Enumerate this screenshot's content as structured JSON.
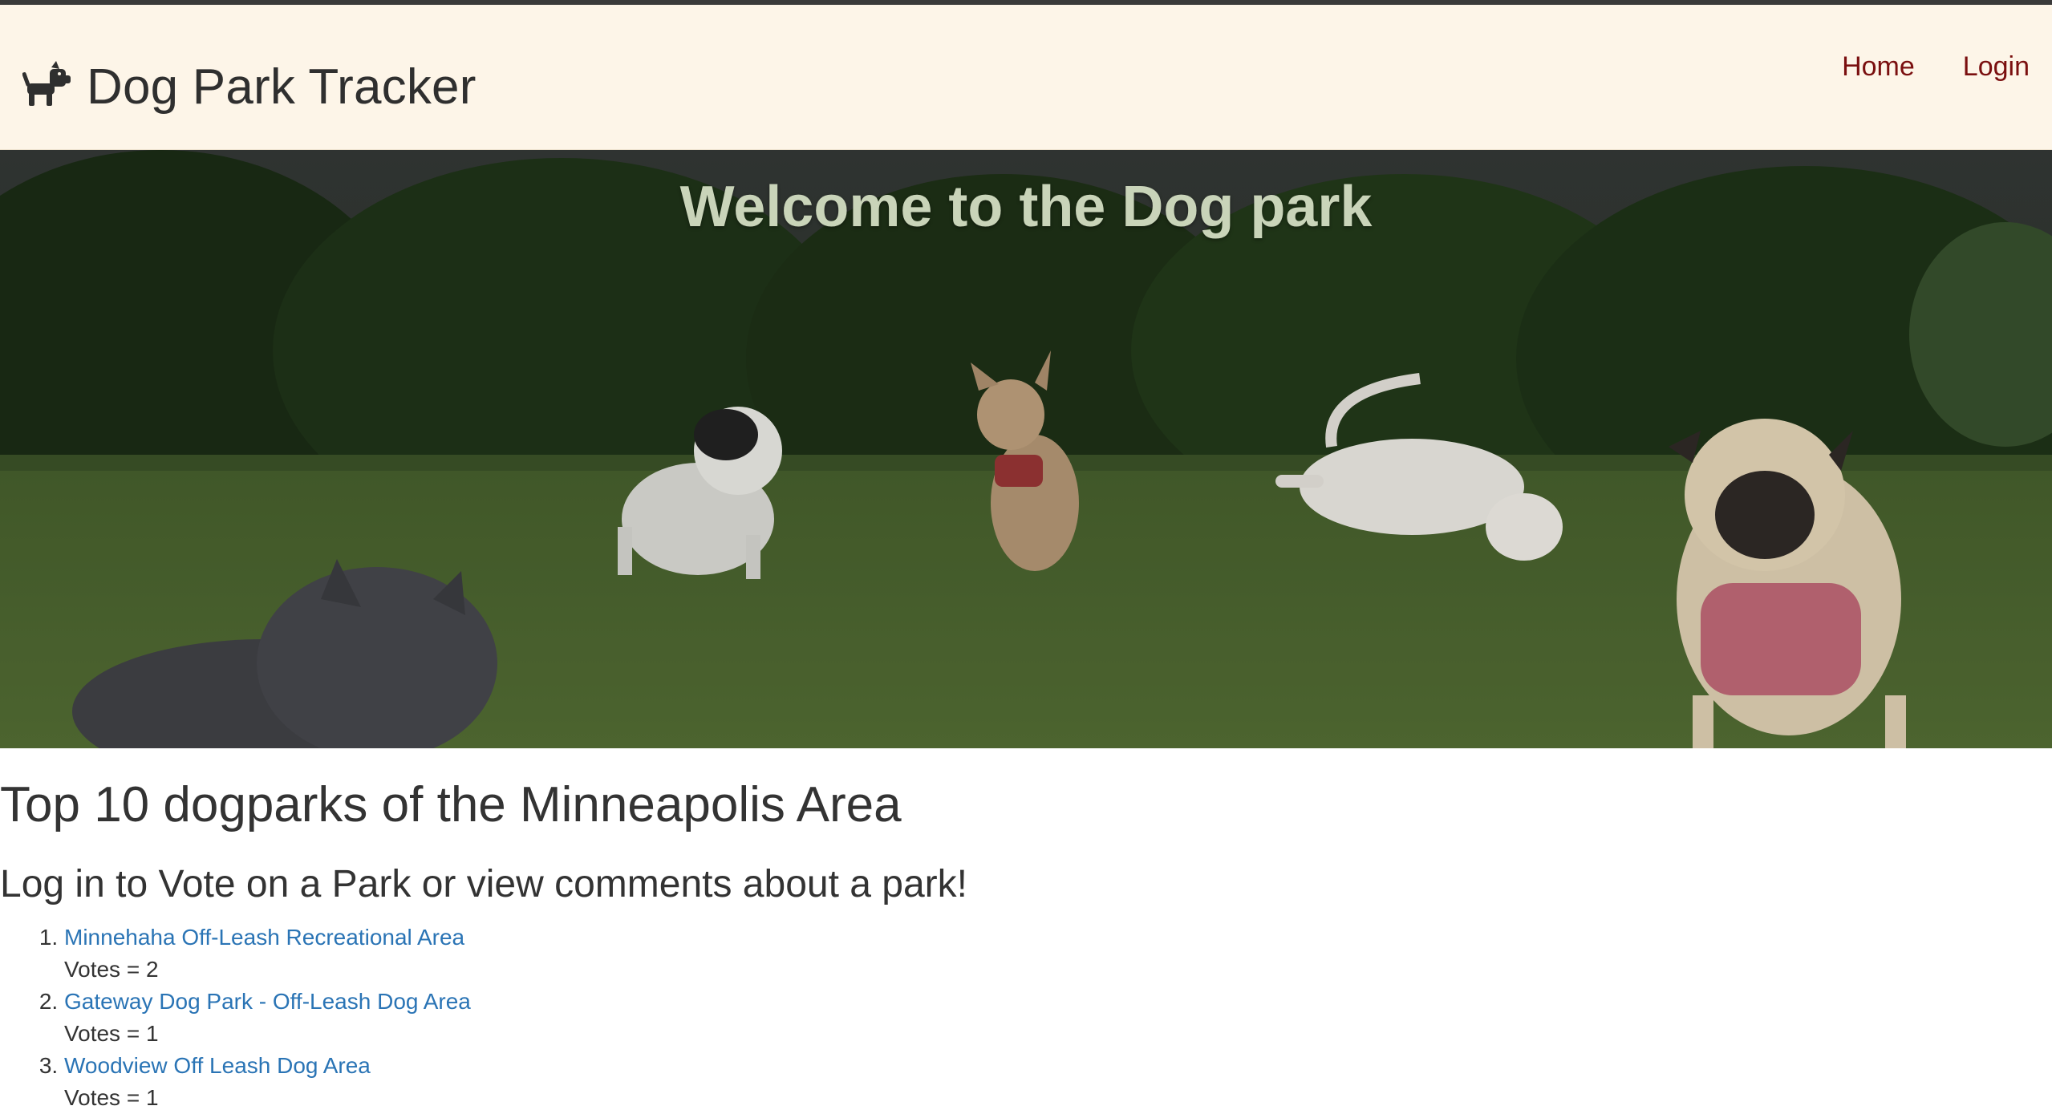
{
  "navbar": {
    "brand_icon": "dog-icon",
    "brand_title": "Dog Park Tracker",
    "links": [
      {
        "label": "Home"
      },
      {
        "label": "Login"
      }
    ],
    "link_color": "#7a0f0f",
    "background": "#fdf5e8"
  },
  "hero": {
    "title": "Welcome to the Dog park",
    "image_description_icon": "dog-park-photo"
  },
  "main": {
    "heading": "Top 10 dogparks of the Minneapolis Area",
    "subheading": "Log in to Vote on a Park or view comments about a park!",
    "parks": [
      {
        "name": "Minnehaha Off-Leash Recreational Area",
        "votes": "Votes = 2"
      },
      {
        "name": "Gateway Dog Park - Off-Leash Dog Area",
        "votes": "Votes = 1"
      },
      {
        "name": "Woodview Off Leash Dog Area",
        "votes": "Votes = 1"
      }
    ],
    "link_color": "#2a74b5"
  }
}
